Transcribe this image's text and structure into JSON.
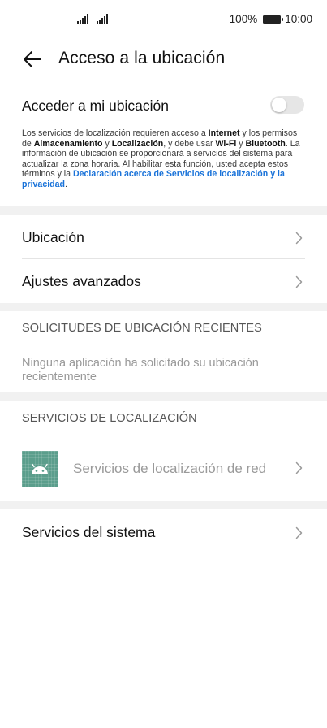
{
  "status_bar": {
    "battery_percent": "100%",
    "time": "10:00"
  },
  "header": {
    "title": "Acceso a la ubicación"
  },
  "location_toggle": {
    "label": "Acceder a mi ubicación",
    "enabled": false
  },
  "description": {
    "t1": "Los servicios de localización requieren acceso a ",
    "b1": "Internet",
    "t2": " y los permisos de ",
    "b2": "Almacenamiento",
    "t3": " y ",
    "b3": "Localización",
    "t4": ", y debe usar ",
    "b4": "Wi-Fi",
    "t5": " y ",
    "b5": "Bluetooth",
    "t6": ". La información de ubicación se proporcionará a servicios del sistema para actualizar la zona horaria. Al habilitar esta función, usted acepta estos términos y la ",
    "link": "Declaración acerca de Servicios de localización y la privacidad",
    "t7": "."
  },
  "menu": {
    "location": "Ubicación",
    "advanced": "Ajustes avanzados",
    "system_services": "Servicios del sistema"
  },
  "recent_requests": {
    "header": "SOLICITUDES DE UBICACIÓN RECIENTES",
    "empty": "Ninguna aplicación ha solicitado su ubicación recientemente"
  },
  "location_services": {
    "header": "SERVICIOS DE LOCALIZACIÓN",
    "network_service": "Servicios de localización de red",
    "network_service_icon": "android-icon"
  },
  "colors": {
    "link": "#1a73d9",
    "divider": "#f1f1f1",
    "app_icon_bg": "#5b9e8c"
  }
}
